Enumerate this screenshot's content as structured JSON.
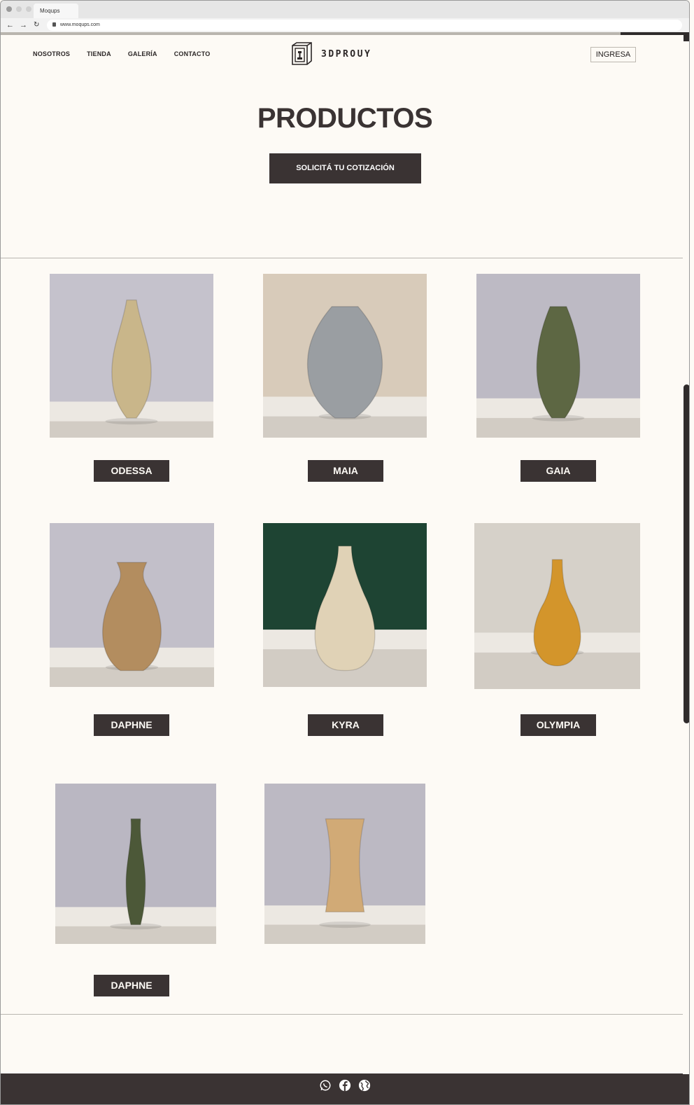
{
  "browser": {
    "tab_title": "Moqups",
    "url": "www.moqups.com",
    "back_icon": "arrow-left-icon",
    "forward_icon": "arrow-right-icon",
    "reload_icon": "reload-icon"
  },
  "header": {
    "nav": [
      "NOSOTROS",
      "TIENDA",
      "GALERÍA",
      "CONTACTO"
    ],
    "logo_text": "3DPROUY",
    "login_label": "INGRESA"
  },
  "hero": {
    "title": "PRODUCTOS",
    "cta_label": "SOLICITÁ TU COTIZACIÓN"
  },
  "products": [
    {
      "name": "ODESSA",
      "bg": "#c5c2cc",
      "vase": "#c9b68a"
    },
    {
      "name": "MAIA",
      "bg": "#d8cbba",
      "vase": "#9a9ea2"
    },
    {
      "name": "GAIA",
      "bg": "#bdbac4",
      "vase": "#5d6743"
    },
    {
      "name": "DAPHNE",
      "bg": "#c2bfc9",
      "vase": "#b38d5f"
    },
    {
      "name": "KYRA",
      "bg": "#1e4433",
      "vase": "#e0d2b6"
    },
    {
      "name": "OLYMPIA",
      "bg": "#d6d1c9",
      "vase": "#d3952b"
    },
    {
      "name": "DAPHNE",
      "bg": "#bab7c2",
      "vase": "#4c5838"
    },
    {
      "name": "",
      "bg": "#bcb9c3",
      "vase": "#d1aa76"
    }
  ],
  "footer": {
    "icons": [
      "whatsapp-icon",
      "facebook-icon",
      "globe-icon"
    ]
  },
  "colors": {
    "page_bg": "#fdfaf5",
    "dark": "#3a3333"
  }
}
